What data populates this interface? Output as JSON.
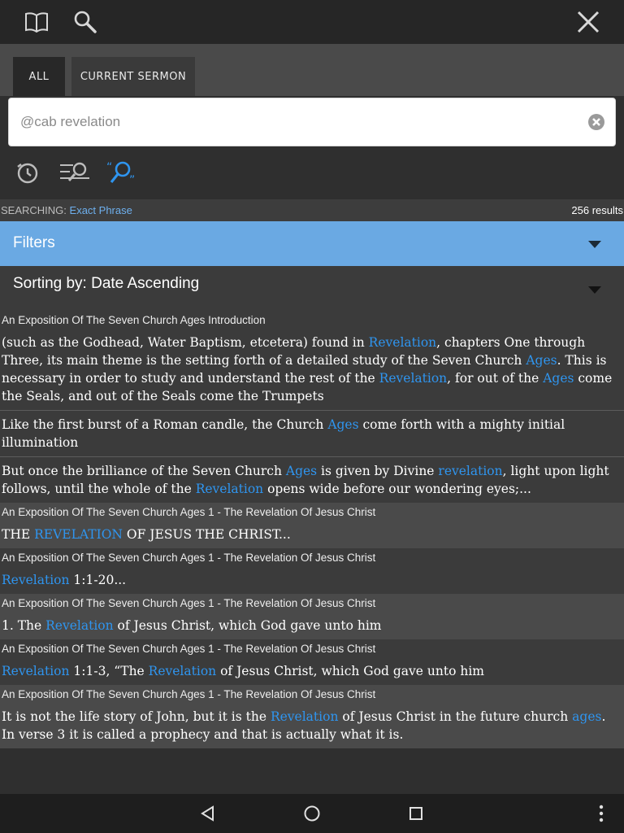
{
  "topbar": {
    "icons": [
      "book-icon",
      "search-icon",
      "close-icon"
    ]
  },
  "tabs": [
    {
      "label": "ALL",
      "active": true
    },
    {
      "label": "CURRENT SERMON",
      "active": false
    }
  ],
  "search": {
    "placeholder": "@cab revelation",
    "value": ""
  },
  "tools": [
    "history-icon",
    "search-options-icon",
    "exact-phrase-icon"
  ],
  "status": {
    "label": "SEARCHING:",
    "mode": "Exact Phrase",
    "count": "256 results"
  },
  "filters": {
    "label": "Filters"
  },
  "sorting": {
    "label": "Sorting by: Date Ascending"
  },
  "colors": {
    "accent": "#6aa9e3",
    "highlight": "#2f95ef"
  },
  "results": [
    {
      "title": "An Exposition Of The Seven Church Ages Introduction",
      "snippets": [
        [
          {
            "t": "(such as the Godhead, Water Baptism, etcetera) found in "
          },
          {
            "t": "Revelation",
            "hl": true
          },
          {
            "t": ", chapters One through Three, its main theme is the setting forth of a detailed study of the Seven Church "
          },
          {
            "t": "Ages",
            "hl": true
          },
          {
            "t": ". This is necessary in order to study and understand the rest of the "
          },
          {
            "t": "Revelation",
            "hl": true
          },
          {
            "t": ", for out of the "
          },
          {
            "t": "Ages",
            "hl": true
          },
          {
            "t": " come the Seals, and out of the Seals come the Trumpets"
          }
        ],
        [
          {
            "t": "Like the first burst of a Roman candle, the Church "
          },
          {
            "t": "Ages",
            "hl": true
          },
          {
            "t": " come forth with a mighty initial illumination"
          }
        ],
        [
          {
            "t": "But once the brilliance of the Seven Church "
          },
          {
            "t": "Ages",
            "hl": true
          },
          {
            "t": " is given by Divine "
          },
          {
            "t": "revelation",
            "hl": true
          },
          {
            "t": ", light upon light follows, until the whole of the "
          },
          {
            "t": "Revelation",
            "hl": true
          },
          {
            "t": " opens wide before our wondering eyes;..."
          }
        ]
      ]
    },
    {
      "title": "An Exposition Of The Seven Church Ages 1 - The Revelation Of Jesus Christ",
      "snippets": [
        [
          {
            "t": "THE "
          },
          {
            "t": "REVELATION",
            "hl": true
          },
          {
            "t": " OF JESUS THE CHRIST..."
          }
        ]
      ]
    },
    {
      "title": "An Exposition Of The Seven Church Ages 1 - The Revelation Of Jesus Christ",
      "snippets": [
        [
          {
            "t": "Revelation",
            "hl": true
          },
          {
            "t": " 1:1-20..."
          }
        ]
      ]
    },
    {
      "title": "An Exposition Of The Seven Church Ages 1 - The Revelation Of Jesus Christ",
      "snippets": [
        [
          {
            "t": "1. The "
          },
          {
            "t": "Revelation",
            "hl": true
          },
          {
            "t": " of Jesus Christ, which God gave unto him"
          }
        ]
      ]
    },
    {
      "title": "An Exposition Of The Seven Church Ages 1 - The Revelation Of Jesus Christ",
      "snippets": [
        [
          {
            "t": "Revelation",
            "hl": true
          },
          {
            "t": " 1:1-3, “The "
          },
          {
            "t": "Revelation",
            "hl": true
          },
          {
            "t": " of Jesus Christ, which God gave unto him"
          }
        ]
      ]
    },
    {
      "title": "An Exposition Of The Seven Church Ages 1 - The Revelation Of Jesus Christ",
      "snippets": [
        [
          {
            "t": "It is not the life story of John, but it is the "
          },
          {
            "t": "Revelation",
            "hl": true
          },
          {
            "t": " of Jesus Christ in the future church "
          },
          {
            "t": "ages",
            "hl": true
          },
          {
            "t": ". In verse 3 it is called a prophecy and that is actually what it is."
          }
        ]
      ]
    }
  ],
  "navbar": {
    "icons": [
      "back-icon",
      "home-icon",
      "recents-icon",
      "overflow-menu-icon"
    ]
  }
}
